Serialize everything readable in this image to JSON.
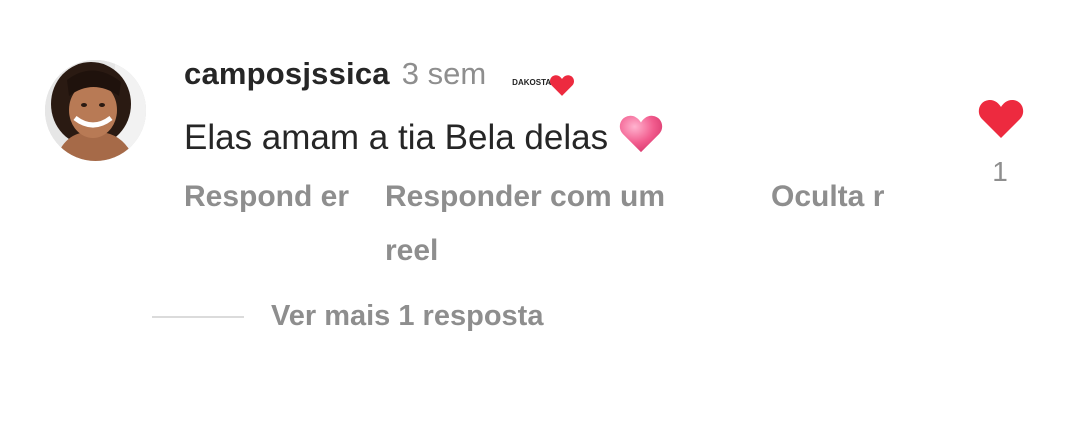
{
  "comment": {
    "username": "camposjssica",
    "time": "3 sem",
    "badge": {
      "logo_text": "DAKOSTA",
      "icon": "heart-icon"
    },
    "text": "Elas amam a tia Bela delas",
    "text_emoji": "pink-heart-emoji",
    "actions": {
      "reply": "Respond er",
      "reply_with_reel": "Responder com um reel",
      "hide": "Oculta r"
    },
    "like": {
      "icon": "heart-icon",
      "count": "1",
      "color": "#ed2a3f"
    }
  },
  "more_replies": "Ver mais 1 resposta"
}
